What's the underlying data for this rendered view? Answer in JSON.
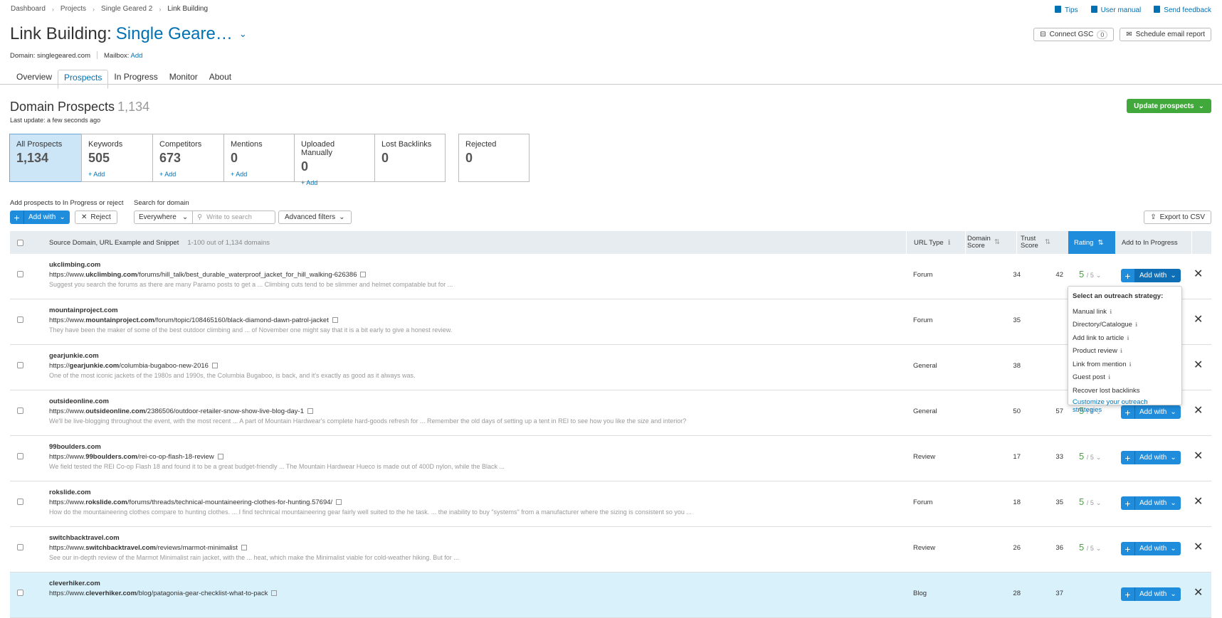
{
  "breadcrumb": [
    "Dashboard",
    "Projects",
    "Single Geared 2",
    "Link Building"
  ],
  "top_links": {
    "tips": "Tips",
    "manual": "User manual",
    "feedback": "Send feedback"
  },
  "title": {
    "prefix": "Link Building:",
    "project": "Single Geare…"
  },
  "header_buttons": {
    "gsc": "Connect GSC",
    "gsc_count": "0",
    "schedule": "Schedule email report"
  },
  "domain_line": {
    "domain": "Domain: singlegeared.com",
    "mailbox": "Mailbox:",
    "mailbox_add": "Add"
  },
  "tabs": [
    "Overview",
    "Prospects",
    "In Progress",
    "Monitor",
    "About"
  ],
  "section": {
    "title": "Domain Prospects",
    "count": "1,134",
    "last_update": "Last update: a few seconds ago",
    "update_btn": "Update prospects"
  },
  "cards": [
    {
      "label": "All Prospects",
      "value": "1,134",
      "add": ""
    },
    {
      "label": "Keywords",
      "value": "505",
      "add": "+ Add"
    },
    {
      "label": "Competitors",
      "value": "673",
      "add": "+ Add"
    },
    {
      "label": "Mentions",
      "value": "0",
      "add": "+ Add"
    },
    {
      "label": "Uploaded Manually",
      "value": "0",
      "add": "+ Add"
    },
    {
      "label": "Lost Backlinks",
      "value": "0",
      "add": ""
    },
    {
      "label": "Rejected",
      "value": "0",
      "add": ""
    }
  ],
  "controls": {
    "add_label": "Add prospects to In Progress or reject",
    "search_label": "Search for domain",
    "add_with": "Add with",
    "reject": "Reject",
    "scope": "Everywhere",
    "search_placeholder": "Write to search",
    "advanced": "Advanced filters",
    "export": "Export to CSV"
  },
  "table": {
    "col_source": "Source Domain, URL Example and Snippet",
    "range": "1-100 out of 1,134 domains",
    "col_type": "URL Type",
    "col_ds": "Domain Score",
    "col_ts": "Trust Score",
    "col_rating": "Rating",
    "col_add": "Add to In Progress"
  },
  "rows": [
    {
      "domain": "ukclimbing.com",
      "url_pre": "https://www.",
      "url_dom": "ukclimbing.com",
      "url_post": "/forums/hill_talk/best_durable_waterproof_jacket_for_hill_walking-626386",
      "snippet": "Suggest you search the forums as there are many Paramo posts to get a ... Climbing cuts tend to be slimmer and helmet compatable but for ...",
      "type": "Forum",
      "ds": "34",
      "ts": "42",
      "rating": "5",
      "rmax": "/ 5"
    },
    {
      "domain": "mountainproject.com",
      "url_pre": "https://www.",
      "url_dom": "mountainproject.com",
      "url_post": "/forum/topic/108465160/black-diamond-dawn-patrol-jacket",
      "snippet": "They have been the maker of some of the best outdoor climbing and ... of November one might say that it is a bit early to give a honest review.",
      "type": "Forum",
      "ds": "35",
      "ts": "",
      "rating": "",
      "rmax": ""
    },
    {
      "domain": "gearjunkie.com",
      "url_pre": "https://",
      "url_dom": "gearjunkie.com",
      "url_post": "/columbia-bugaboo-new-2016",
      "snippet": "One of the most iconic jackets of the 1980s and 1990s, the Columbia Bugaboo, is back, and it's exactly as good as it always was.",
      "type": "General",
      "ds": "38",
      "ts": "",
      "rating": "",
      "rmax": ""
    },
    {
      "domain": "outsideonline.com",
      "url_pre": "https://www.",
      "url_dom": "outsideonline.com",
      "url_post": "/2386506/outdoor-retailer-snow-show-live-blog-day-1",
      "snippet": "We'll be live-blogging throughout the event, with the most recent ... A part of Mountain Hardwear's complete hard-goods refresh for ... Remember the old days of setting up a tent in REI to see how you like the size and interior?",
      "type": "General",
      "ds": "50",
      "ts": "57",
      "rating": "5",
      "rmax": "/ 5"
    },
    {
      "domain": "99boulders.com",
      "url_pre": "https://www.",
      "url_dom": "99boulders.com",
      "url_post": "/rei-co-op-flash-18-review",
      "snippet": "We field tested the REI Co-op Flash 18 and found it to be a great budget-friendly ... The Mountain Hardwear Hueco is made out of 400D nylon, while the Black ...",
      "type": "Review",
      "ds": "17",
      "ts": "33",
      "rating": "5",
      "rmax": "/ 5"
    },
    {
      "domain": "rokslide.com",
      "url_pre": "https://www.",
      "url_dom": "rokslide.com",
      "url_post": "/forums/threads/technical-mountaineering-clothes-for-hunting.57694/",
      "snippet": "How do the mountaineering clothes compare to hunting clothes. ... I find technical mountaineering gear fairly well suited to the he task. ... the inability to buy \"systems\" from a manufacturer where the sizing is consistent so you ...",
      "type": "Forum",
      "ds": "18",
      "ts": "35",
      "rating": "5",
      "rmax": "/ 5"
    },
    {
      "domain": "switchbacktravel.com",
      "url_pre": "https://www.",
      "url_dom": "switchbacktravel.com",
      "url_post": "/reviews/marmot-minimalist",
      "snippet": "See our in-depth review of the Marmot Minimalist rain jacket, with the ... heat, which make the Minimalist viable for cold-weather hiking. But for ...",
      "type": "Review",
      "ds": "26",
      "ts": "36",
      "rating": "5",
      "rmax": "/ 5"
    },
    {
      "domain": "cleverhiker.com",
      "url_pre": "https://www.",
      "url_dom": "cleverhiker.com",
      "url_post": "/blog/patagonia-gear-checklist-what-to-pack",
      "snippet": "",
      "type": "Blog",
      "ds": "28",
      "ts": "37",
      "rating": "",
      "rmax": ""
    }
  ],
  "dropdown": {
    "header": "Select an outreach strategy:",
    "items": [
      "Manual link",
      "Directory/Catalogue",
      "Add link to article",
      "Product review",
      "Link from mention",
      "Guest post",
      "Recover lost backlinks"
    ],
    "customize": "Customize your outreach strategies"
  }
}
